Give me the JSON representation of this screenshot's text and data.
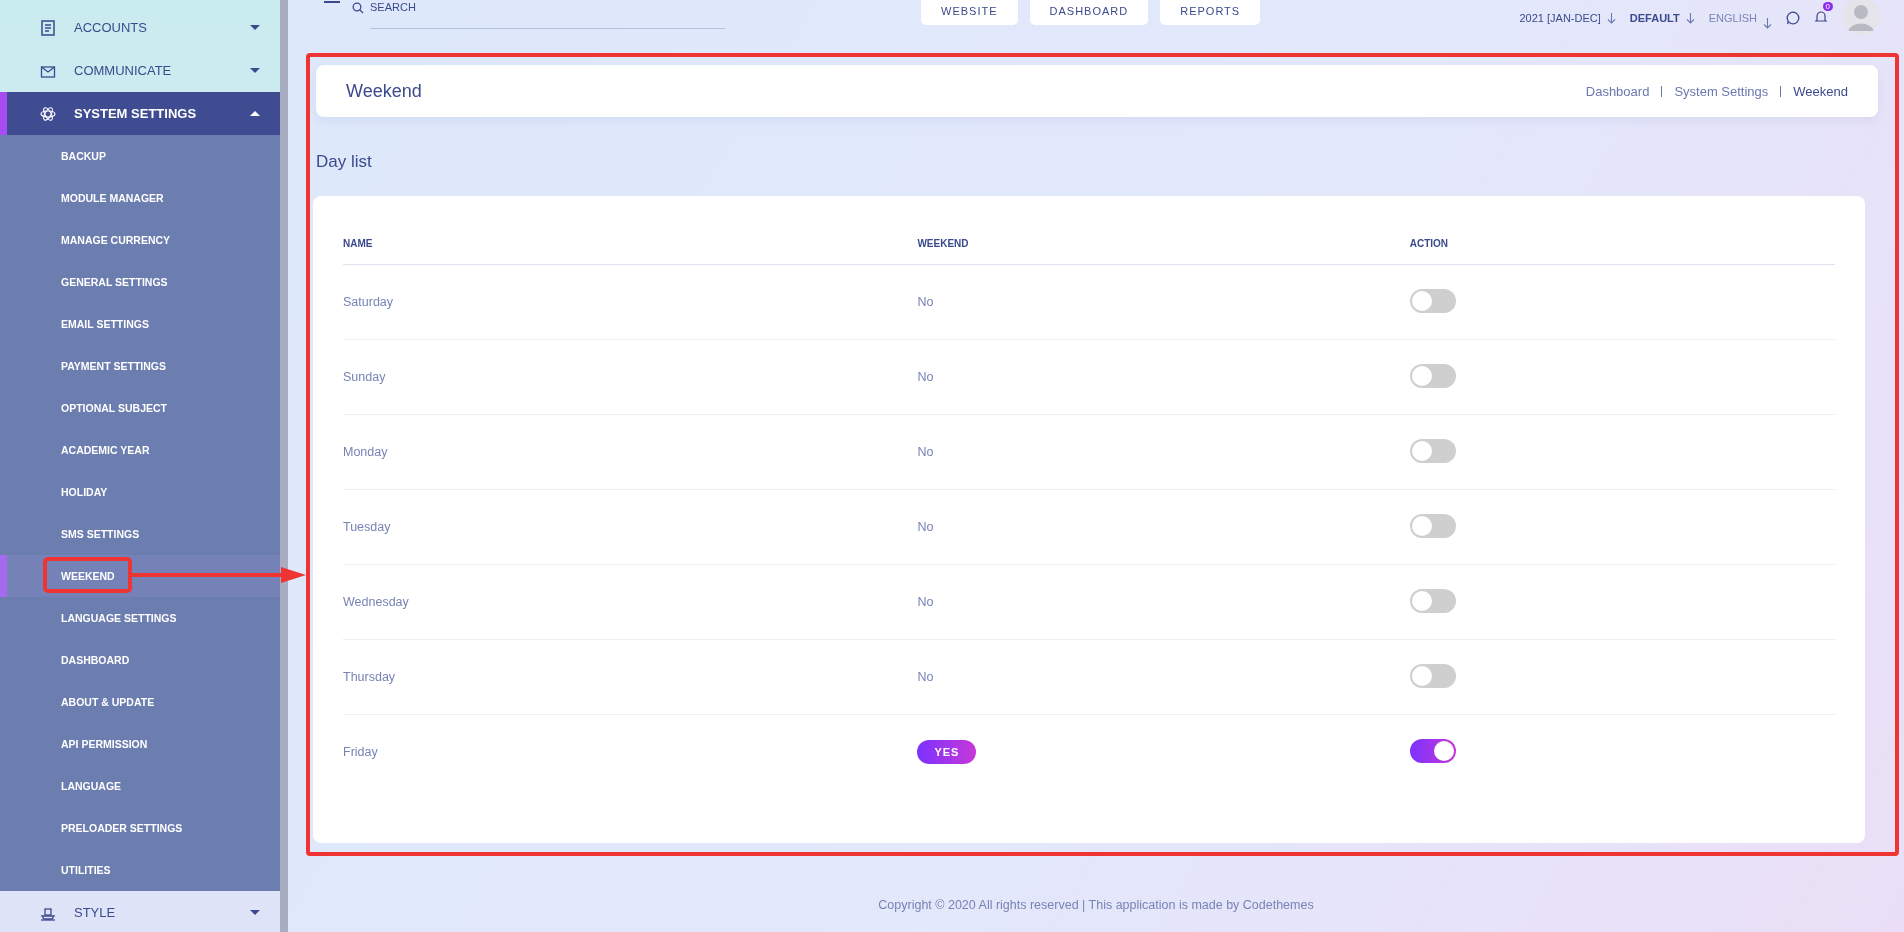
{
  "sidebar": {
    "items": [
      {
        "label": "ACCOUNTS",
        "expanded": false,
        "selected": false
      },
      {
        "label": "COMMUNICATE",
        "expanded": false,
        "selected": false
      },
      {
        "label": "SYSTEM SETTINGS",
        "expanded": true,
        "selected": true,
        "children": [
          {
            "label": "BACKUP",
            "selected": false
          },
          {
            "label": "MODULE MANAGER",
            "selected": false
          },
          {
            "label": "MANAGE CURRENCY",
            "selected": false
          },
          {
            "label": "GENERAL SETTINGS",
            "selected": false
          },
          {
            "label": "EMAIL SETTINGS",
            "selected": false
          },
          {
            "label": "PAYMENT SETTINGS",
            "selected": false
          },
          {
            "label": "OPTIONAL SUBJECT",
            "selected": false
          },
          {
            "label": "ACADEMIC YEAR",
            "selected": false
          },
          {
            "label": "HOLIDAY",
            "selected": false
          },
          {
            "label": "SMS SETTINGS",
            "selected": false
          },
          {
            "label": "WEEKEND",
            "selected": true
          },
          {
            "label": "LANGUAGE SETTINGS",
            "selected": false
          },
          {
            "label": "DASHBOARD",
            "selected": false
          },
          {
            "label": "ABOUT & UPDATE",
            "selected": false
          },
          {
            "label": "API PERMISSION",
            "selected": false
          },
          {
            "label": "LANGUAGE",
            "selected": false
          },
          {
            "label": "PRELOADER SETTINGS",
            "selected": false
          },
          {
            "label": "UTILITIES",
            "selected": false
          }
        ]
      },
      {
        "label": "STYLE",
        "expanded": false,
        "selected": false
      }
    ]
  },
  "top_bar": {
    "search": {
      "placeholder": "SEARCH"
    },
    "nav_buttons": [
      "WEBSITE",
      "DASHBOARD",
      "REPORTS"
    ],
    "session": "2021 [JAN-DEC]",
    "theme": "DEFAULT",
    "language": "ENGLISH",
    "notifications": "0"
  },
  "page": {
    "title": "Weekend",
    "breadcrumbs": [
      "Dashboard",
      "System Settings",
      "Weekend"
    ],
    "section_title": "Day list",
    "table": {
      "columns": [
        "NAME",
        "WEEKEND",
        "ACTION"
      ],
      "rows": [
        {
          "name": "Saturday",
          "weekend": "No",
          "on": false
        },
        {
          "name": "Sunday",
          "weekend": "No",
          "on": false
        },
        {
          "name": "Monday",
          "weekend": "No",
          "on": false
        },
        {
          "name": "Tuesday",
          "weekend": "No",
          "on": false
        },
        {
          "name": "Wednesday",
          "weekend": "No",
          "on": false
        },
        {
          "name": "Thursday",
          "weekend": "No",
          "on": false
        },
        {
          "name": "Friday",
          "weekend": "YES",
          "on": true
        }
      ]
    }
  },
  "footer": "Copyright © 2020 All rights reserved | This application is made by Codethemes"
}
